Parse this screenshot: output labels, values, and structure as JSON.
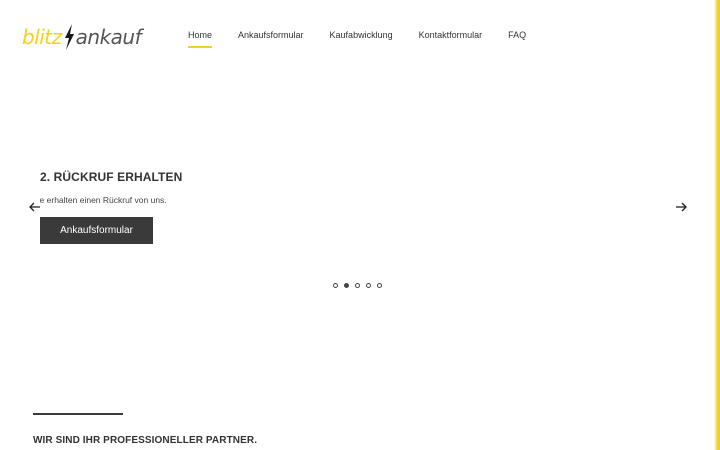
{
  "colors": {
    "accent": "#f2d21a",
    "dark": "#3a3a3a"
  },
  "logo": {
    "part_a": "blitz",
    "part_b": "ankauf",
    "icon": "lightning-bolt-icon"
  },
  "nav": {
    "items": [
      {
        "label": "Home",
        "active": true
      },
      {
        "label": "Ankaufsformular"
      },
      {
        "label": "Kaufabwicklung"
      },
      {
        "label": "Kontaktformular"
      },
      {
        "label": "FAQ"
      }
    ]
  },
  "slider": {
    "title": "2. RÜCKRUF ERHALTEN",
    "text": "Sie erhalten einen Rückruf von uns.",
    "button_label": "Ankaufsformular",
    "prev_icon": "arrow-left-icon",
    "next_icon": "arrow-right-icon",
    "slide_count": 5,
    "active_slide": 2
  },
  "section": {
    "heading": "WIR SIND IHR PROFESSIONELLER PARTNER."
  }
}
